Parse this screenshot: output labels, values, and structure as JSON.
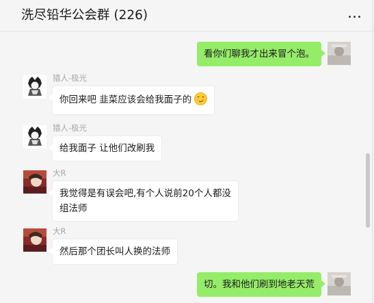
{
  "chat": {
    "title": "洗尽铅华公会群 (226)"
  },
  "messages": [
    {
      "side": "out",
      "text": "看你们聊我才出来冒个泡。"
    },
    {
      "side": "in",
      "sender": "猎人-极光",
      "text": "你回来吧 韭菜应该会给我面子的",
      "emoji": "smirk-emoji"
    },
    {
      "side": "in",
      "sender": "猎人-极光",
      "text": "给我面子 让他们改刷我"
    },
    {
      "side": "in",
      "sender": "大R",
      "text_line1": "我觉得是有误会吧,有个人说前20个人都没",
      "text_line2": "组法师"
    },
    {
      "side": "in",
      "sender": "大R",
      "text": "然后那个团长叫人换的法师"
    },
    {
      "side": "out",
      "text": "切。我和他们刷到地老天荒"
    }
  ],
  "icons": {
    "more": "more-horizontal-icon",
    "emoji": "smirk-emoji-icon"
  },
  "colors": {
    "outgoing_bubble": "#95ec69",
    "incoming_bubble": "#ffffff",
    "background": "#f5f5f5",
    "sender_name": "#a6a6a6"
  }
}
